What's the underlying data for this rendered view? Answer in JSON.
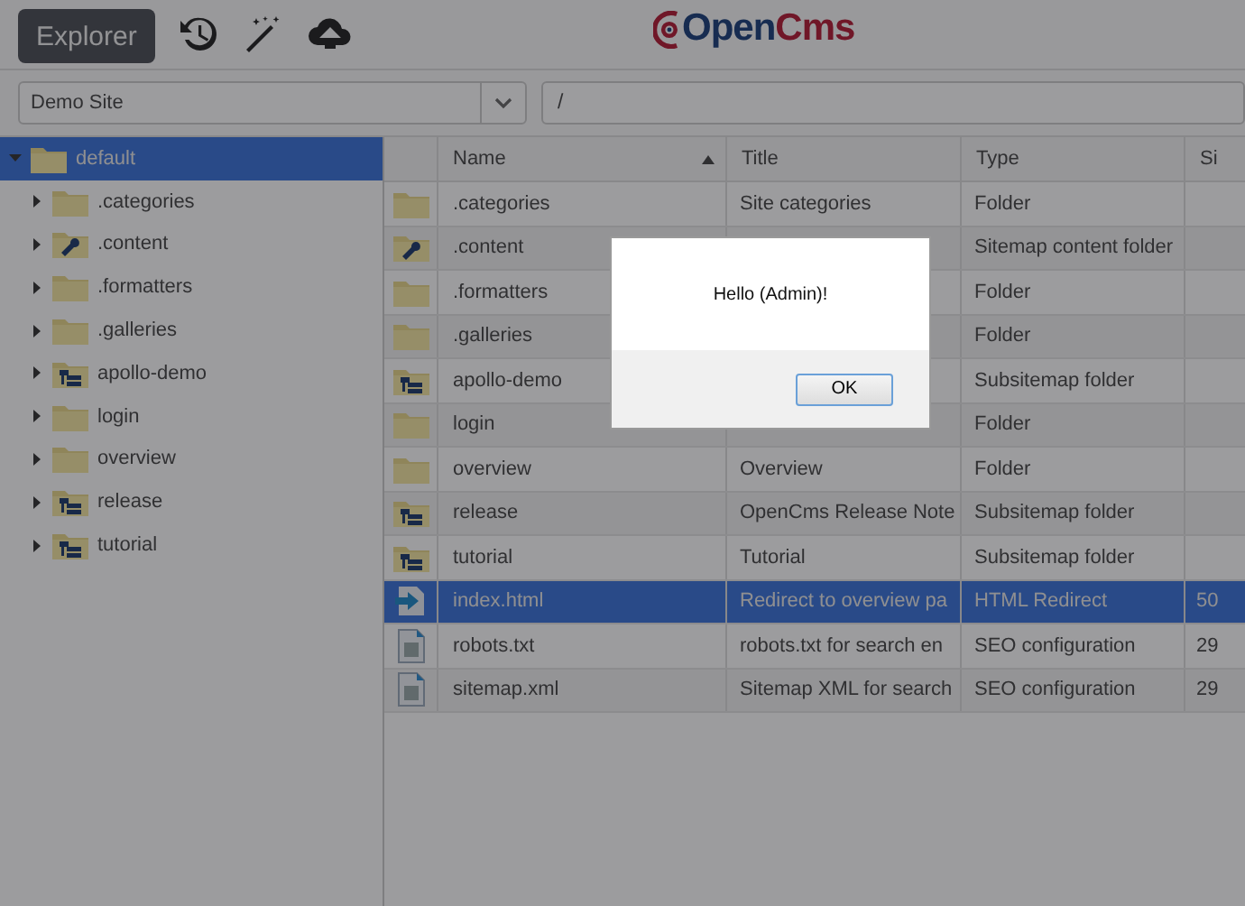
{
  "toolbar": {
    "app_button": "Explorer",
    "logo": {
      "parts": [
        "Open",
        "Cms"
      ]
    }
  },
  "site_select": {
    "value": "Demo Site"
  },
  "path_field": {
    "value": "/"
  },
  "tree": {
    "label": "default",
    "kind": "folder",
    "expanded": true,
    "selected": true,
    "children": [
      {
        "label": ".categories",
        "kind": "folder",
        "expanded": false,
        "selected": false
      },
      {
        "label": ".content",
        "kind": "content",
        "expanded": false,
        "selected": false
      },
      {
        "label": ".formatters",
        "kind": "folder",
        "expanded": false,
        "selected": false
      },
      {
        "label": ".galleries",
        "kind": "folder",
        "expanded": false,
        "selected": false
      },
      {
        "label": "apollo-demo",
        "kind": "subsitemap",
        "expanded": false,
        "selected": false
      },
      {
        "label": "login",
        "kind": "folder",
        "expanded": false,
        "selected": false
      },
      {
        "label": "overview",
        "kind": "folder",
        "expanded": false,
        "selected": false
      },
      {
        "label": "release",
        "kind": "subsitemap",
        "expanded": false,
        "selected": false
      },
      {
        "label": "tutorial",
        "kind": "subsitemap",
        "expanded": false,
        "selected": false
      }
    ]
  },
  "table": {
    "columns": [
      {
        "label": "Name",
        "sorted": true
      },
      {
        "label": "Title",
        "sorted": false
      },
      {
        "label": "Type",
        "sorted": false
      },
      {
        "label": "Si",
        "sorted": false
      }
    ],
    "rows": [
      {
        "kind": "folder",
        "name": ".categories",
        "title": "Site categories",
        "type": "Folder",
        "selected": false
      },
      {
        "kind": "content",
        "name": ".content",
        "type": "Sitemap content folder",
        "selected": false
      },
      {
        "kind": "folder",
        "name": ".formatters",
        "type": "Folder",
        "selected": false
      },
      {
        "kind": "folder",
        "name": ".galleries",
        "type": "Folder",
        "selected": false
      },
      {
        "kind": "subsitemap",
        "name": "apollo-demo",
        "type": "Subsitemap folder",
        "selected": false
      },
      {
        "kind": "folder",
        "name": "login",
        "type": "Folder",
        "selected": false
      },
      {
        "kind": "folder",
        "name": "overview",
        "title": "Overview",
        "type": "Folder",
        "selected": false
      },
      {
        "kind": "subsitemap",
        "name": "release",
        "title": "OpenCms Release Note",
        "type": "Subsitemap folder",
        "selected": false
      },
      {
        "kind": "subsitemap",
        "name": "tutorial",
        "title": "Tutorial",
        "type": "Subsitemap folder",
        "selected": false
      },
      {
        "kind": "redirect",
        "name": "index.html",
        "title": "Redirect to overview pa",
        "type": "HTML Redirect",
        "size": "50",
        "selected": true
      },
      {
        "kind": "file",
        "name": "robots.txt",
        "title": "robots.txt for search en",
        "type": "SEO configuration",
        "size": "29",
        "selected": false
      },
      {
        "kind": "file",
        "name": "sitemap.xml",
        "title": "Sitemap XML for search",
        "type": "SEO configuration",
        "size": "29",
        "selected": false
      }
    ]
  },
  "dialog": {
    "message": "Hello (Admin)!",
    "button": "OK"
  }
}
